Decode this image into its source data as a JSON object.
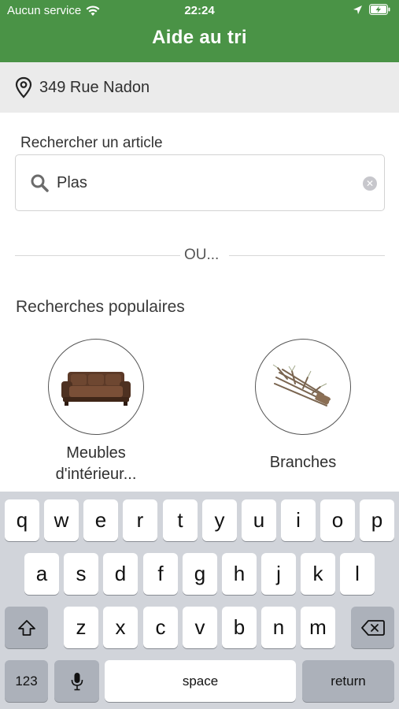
{
  "status_bar": {
    "carrier": "Aucun service",
    "time": "22:24"
  },
  "header": {
    "title": "Aide au tri"
  },
  "address": {
    "text": "349 Rue Nadon",
    "icon": "location-pin-icon"
  },
  "search": {
    "label": "Rechercher un article",
    "value": "Plas",
    "clear_icon": "clear-icon",
    "search_icon": "search-icon"
  },
  "divider": {
    "text": "OU..."
  },
  "popular": {
    "title": "Recherches populaires",
    "items": [
      {
        "label_line1": "Meubles",
        "label_line2": "d'intérieur...",
        "icon": "sofa-image"
      },
      {
        "label": "Branches",
        "icon": "branches-image"
      }
    ]
  },
  "keyboard": {
    "row1": [
      "q",
      "w",
      "e",
      "r",
      "t",
      "y",
      "u",
      "i",
      "o",
      "p"
    ],
    "row2": [
      "a",
      "s",
      "d",
      "f",
      "g",
      "h",
      "j",
      "k",
      "l"
    ],
    "row3": [
      "z",
      "x",
      "c",
      "v",
      "b",
      "n",
      "m"
    ],
    "numbers_label": "123",
    "space_label": "space",
    "return_label": "return"
  },
  "colors": {
    "header_green": "#4a9346",
    "keyboard_bg": "#d1d4da"
  }
}
